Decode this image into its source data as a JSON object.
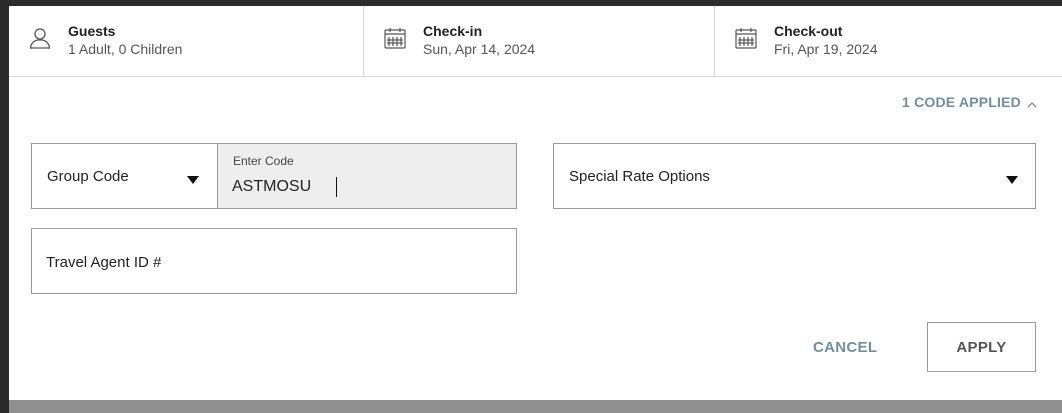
{
  "booking_bar": {
    "guests": {
      "title": "Guests",
      "value": "1 Adult, 0 Children",
      "icon": "person-icon"
    },
    "check_in": {
      "title": "Check-in",
      "value": "Sun, Apr 14, 2024",
      "icon": "calendar-icon"
    },
    "check_out": {
      "title": "Check-out",
      "value": "Fri, Apr 19, 2024",
      "icon": "calendar-icon"
    }
  },
  "codes_panel": {
    "applied_toggle": "1 CODE APPLIED",
    "applied_toggle_icon": "chevron-up-icon",
    "code_type_select": {
      "selected": "Group Code",
      "icon": "caret-down-icon"
    },
    "code_input": {
      "label": "Enter Code",
      "value": "ASTMOSU"
    },
    "special_rate_select": {
      "selected": "Special Rate Options",
      "icon": "caret-down-icon"
    },
    "travel_agent_input": {
      "placeholder": "Travel Agent ID #",
      "value": ""
    },
    "actions": {
      "cancel_label": "CANCEL",
      "apply_label": "APPLY"
    }
  },
  "colors": {
    "accent_link": "#6f8ea3",
    "input_border": "#9a9a9a",
    "active_input_bg": "#eeeeee",
    "page_frame": "#2b2b2b"
  }
}
